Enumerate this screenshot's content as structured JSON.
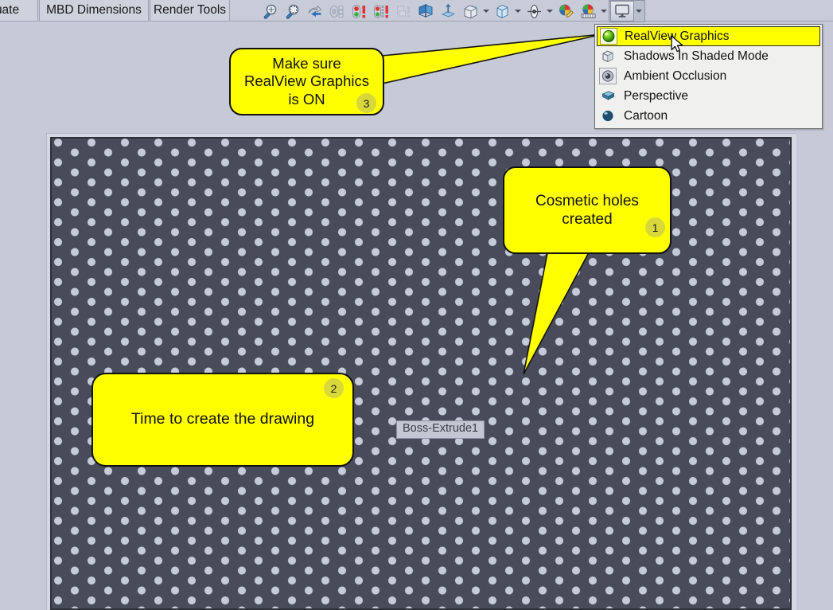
{
  "ribbon": {
    "tabs": [
      {
        "id": "evaluate",
        "label": "aluate"
      },
      {
        "id": "mbd_dimensions",
        "label": "MBD Dimensions"
      },
      {
        "id": "render_tools",
        "label": "Render Tools"
      }
    ]
  },
  "toolbar": {
    "items": [
      {
        "name": "zoom-to-fit-icon",
        "has_caret": false
      },
      {
        "name": "zoom-to-area-icon",
        "has_caret": false
      },
      {
        "name": "previous-view-icon",
        "has_caret": false
      },
      {
        "name": "view-orientation-icon",
        "has_caret": false
      },
      {
        "name": "display-state-red-icon",
        "has_caret": false
      },
      {
        "name": "display-state-multi-icon",
        "has_caret": false
      },
      {
        "name": "hide-show-disabled-icon",
        "has_caret": false
      },
      {
        "name": "section-view-icon",
        "has_caret": false
      },
      {
        "name": "view-orientation-axis-icon",
        "has_caret": false
      },
      {
        "name": "display-style-box-icon",
        "has_caret": true
      },
      {
        "name": "hide-show-items-icon",
        "has_caret": true
      },
      {
        "name": "apply-scene-icon",
        "has_caret": true
      },
      {
        "name": "edit-appearance-icon",
        "has_caret": false
      },
      {
        "name": "scene-backdrop-icon",
        "has_caret": true
      }
    ],
    "display_style_button": {
      "name": "view-settings-button",
      "icon": "monitor-icon",
      "caret": "chevron-down-icon",
      "active": true
    }
  },
  "display_menu": {
    "items": [
      {
        "label": "RealView Graphics",
        "icon": "green-sphere-icon",
        "selected": true,
        "boxed": true
      },
      {
        "label": "Shadows In Shaded Mode",
        "icon": "grey-cube-icon",
        "selected": false,
        "boxed": false
      },
      {
        "label": "Ambient Occlusion",
        "icon": "ambient-sphere-icon",
        "selected": false,
        "boxed": true
      },
      {
        "label": "Perspective",
        "icon": "perspective-wedge-icon",
        "selected": false,
        "boxed": false
      },
      {
        "label": "Cartoon",
        "icon": "cartoon-sphere-icon",
        "selected": false,
        "boxed": false
      }
    ]
  },
  "viewport": {
    "feature_label": "Boss-Extrude1",
    "background_color": "#484c5a",
    "hole_color": "#c6cbd9"
  },
  "callouts": [
    {
      "id": "callout-1",
      "number": "1",
      "text": "Cosmetic holes\ncreated"
    },
    {
      "id": "callout-2",
      "number": "2",
      "text": "Time to create the drawing"
    },
    {
      "id": "callout-3",
      "number": "3",
      "text": "Make sure\nRealView Graphics\nis ON"
    }
  ],
  "colors": {
    "callout_fill": "#ffff00",
    "callout_border": "#111111",
    "badge_fill": "#d8d83a",
    "menu_highlight": "#ffff00",
    "chrome": "#c8ccd8"
  }
}
